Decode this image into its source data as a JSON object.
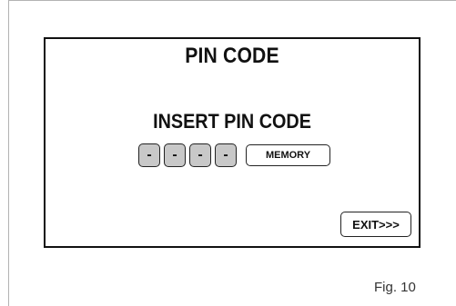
{
  "screen": {
    "title": "PIN CODE",
    "prompt": "INSERT PIN CODE",
    "pin_digits": [
      "-",
      "-",
      "-",
      "-"
    ],
    "memory_label": "MEMORY",
    "exit_label": "EXIT>>>"
  },
  "caption": "Fig. 10"
}
